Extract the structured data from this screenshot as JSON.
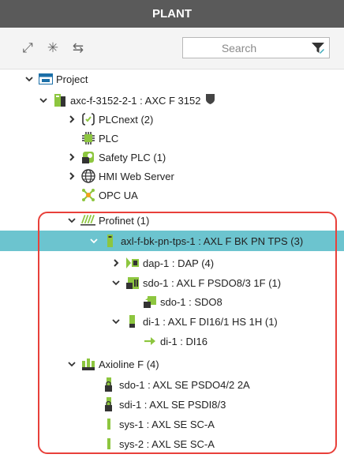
{
  "panel": {
    "title": "PLANT"
  },
  "toolbar": {
    "expand_icon": "expand-arrows-icon",
    "collapse_icon": "collapse-arrows-icon",
    "swap_icon": "swap-arrows-icon",
    "search_placeholder": "Search",
    "filter_icon": "filter-icon"
  },
  "tree": {
    "project": "Project",
    "axc": "axc-f-3152-2-1 : AXC F 3152",
    "plcnext": "PLCnext (2)",
    "plc": "PLC",
    "safety": "Safety PLC (1)",
    "hmi": "HMI Web Server",
    "opc": "OPC UA",
    "profinet": "Profinet (1)",
    "axl_bk": "axl-f-bk-pn-tps-1 : AXL F BK PN TPS (3)",
    "dap": "dap-1 : DAP (4)",
    "sdo_parent": "sdo-1 : AXL F PSDO8/3 1F (1)",
    "sdo_child": "sdo-1 : SDO8",
    "di_parent": "di-1 : AXL F DI16/1 HS 1H (1)",
    "di_child": "di-1 : DI16",
    "axioline": "Axioline F (4)",
    "sdo_se": "sdo-1 : AXL SE PSDO4/2 2A",
    "sdi_se": "sdi-1 : AXL SE PSDI8/3",
    "sys1": "sys-1 : AXL SE SC-A",
    "sys2": "sys-2 : AXL SE SC-A"
  },
  "colors": {
    "header": "#5a5a5a",
    "selection": "#6cc4cf",
    "highlight": "#e8403a",
    "device_green": "#8dc63f"
  }
}
